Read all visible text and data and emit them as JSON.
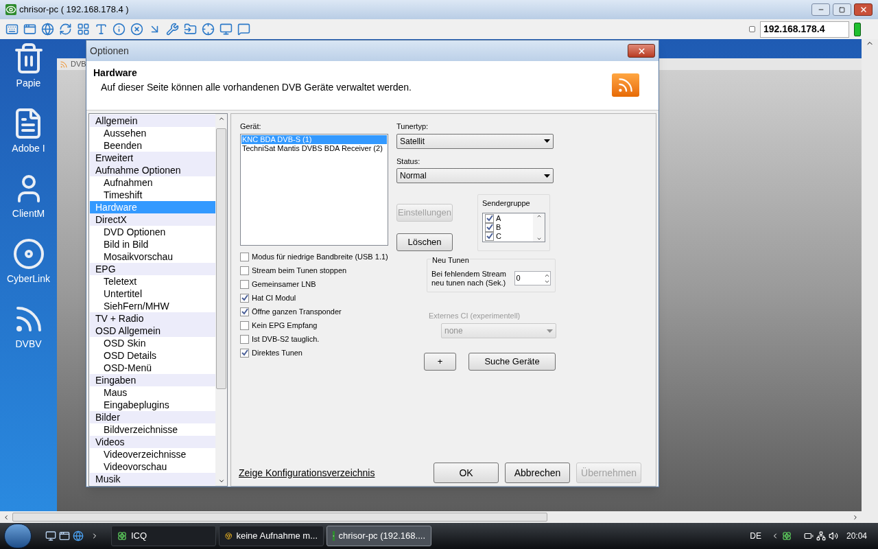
{
  "window": {
    "title": "chrisor-pc ( 192.168.178.4 )"
  },
  "toolbar": {
    "address": "192.168.178.4"
  },
  "desktop_icons": [
    {
      "label": "Papie"
    },
    {
      "label": "Adobe I"
    },
    {
      "label": "ClientM"
    },
    {
      "label": "CyberLink"
    },
    {
      "label": "DVBV"
    }
  ],
  "background_window": {
    "title": "DVB"
  },
  "dialog": {
    "title": "Optionen",
    "header": {
      "title": "Hardware",
      "description": "Auf dieser Seite können alle vorhandenen DVB Geräte verwaltet werden."
    },
    "nav": [
      {
        "label": "Allgemein",
        "selected": false,
        "children": [
          {
            "label": "Aussehen",
            "selected": false
          },
          {
            "label": "Beenden",
            "selected": false
          }
        ]
      },
      {
        "label": "Erweitert",
        "selected": false
      },
      {
        "label": "Aufnahme Optionen",
        "selected": false,
        "children": [
          {
            "label": "Aufnahmen",
            "selected": false
          },
          {
            "label": "Timeshift",
            "selected": false
          }
        ]
      },
      {
        "label": "Hardware",
        "selected": true
      },
      {
        "label": "DirectX",
        "selected": false,
        "children": [
          {
            "label": "DVD Optionen",
            "selected": false
          },
          {
            "label": "Bild in Bild",
            "selected": false
          },
          {
            "label": "Mosaikvorschau",
            "selected": false
          }
        ]
      },
      {
        "label": "EPG",
        "selected": false,
        "children": [
          {
            "label": "Teletext",
            "selected": false
          },
          {
            "label": "Untertitel",
            "selected": false
          },
          {
            "label": "SiehFern/MHW",
            "selected": false
          }
        ]
      },
      {
        "label": "TV + Radio",
        "selected": false
      },
      {
        "label": "OSD Allgemein",
        "selected": false,
        "children": [
          {
            "label": "OSD Skin",
            "selected": false
          },
          {
            "label": "OSD Details",
            "selected": false
          },
          {
            "label": "OSD-Menü",
            "selected": false
          }
        ]
      },
      {
        "label": "Eingaben",
        "selected": false,
        "children": [
          {
            "label": "Maus",
            "selected": false
          },
          {
            "label": "Eingabeplugins",
            "selected": false
          }
        ]
      },
      {
        "label": "Bilder",
        "selected": false,
        "children": [
          {
            "label": "Bildverzeichnisse",
            "selected": false
          }
        ]
      },
      {
        "label": "Videos",
        "selected": false,
        "children": [
          {
            "label": "Videoverzeichnisse",
            "selected": false
          },
          {
            "label": "Videovorschau",
            "selected": false
          }
        ]
      },
      {
        "label": "Musik",
        "selected": false
      }
    ],
    "device": {
      "label": "Gerät:",
      "devices": [
        {
          "name": "KNC BDA DVB-S (1)",
          "selected": true
        },
        {
          "name": "TechniSat Mantis DVBS BDA Receiver (2)",
          "selected": false
        }
      ]
    },
    "options": [
      {
        "label": "Modus für niedrige Bandbreite (USB 1.1)",
        "checked": false
      },
      {
        "label": "Stream beim Tunen stoppen",
        "checked": false
      },
      {
        "label": "Gemeinsamer LNB",
        "checked": false
      },
      {
        "label": "Hat CI Modul",
        "checked": true
      },
      {
        "label": "Öffne ganzen Transponder",
        "checked": true
      },
      {
        "label": "Kein EPG Empfang",
        "checked": false
      },
      {
        "label": "Ist DVB-S2 tauglich.",
        "checked": false
      },
      {
        "label": "Direktes Tunen",
        "checked": true
      }
    ],
    "tuner_type": {
      "label": "Tunertyp:",
      "value": "Satellit"
    },
    "status": {
      "label": "Status:",
      "value": "Normal"
    },
    "side_buttons": [
      {
        "label": "Einstellungen",
        "disabled": true
      },
      {
        "label": "Löschen",
        "disabled": false
      }
    ],
    "channel_group": {
      "title": "Sendergruppe",
      "items": [
        {
          "label": "A",
          "checked": true
        },
        {
          "label": "B",
          "checked": true
        },
        {
          "label": "C",
          "checked": true
        }
      ]
    },
    "retune": {
      "title": "Neu Tunen",
      "label": "Bei fehlendem Stream neu tunen nach (Sek.)",
      "value": "0"
    },
    "external_ci": {
      "label": "Externes CI (experimentell)",
      "value": "none",
      "disabled": true
    },
    "action_buttons": [
      {
        "label": "+"
      },
      {
        "label": "Suche Geräte"
      }
    ],
    "config_link": "Zeige Konfigurationsverzeichnis",
    "footer_buttons": [
      {
        "label": "OK",
        "disabled": false
      },
      {
        "label": "Abbrechen",
        "disabled": false
      },
      {
        "label": "Übernehmen",
        "disabled": true
      }
    ]
  },
  "taskbar": {
    "items": [
      {
        "label": "ICQ",
        "active": false
      },
      {
        "label": "keine Aufnahme m...",
        "active": false
      },
      {
        "label": "chrisor-pc (192.168....",
        "active": true
      }
    ],
    "language": "DE",
    "clock": "20:04"
  }
}
